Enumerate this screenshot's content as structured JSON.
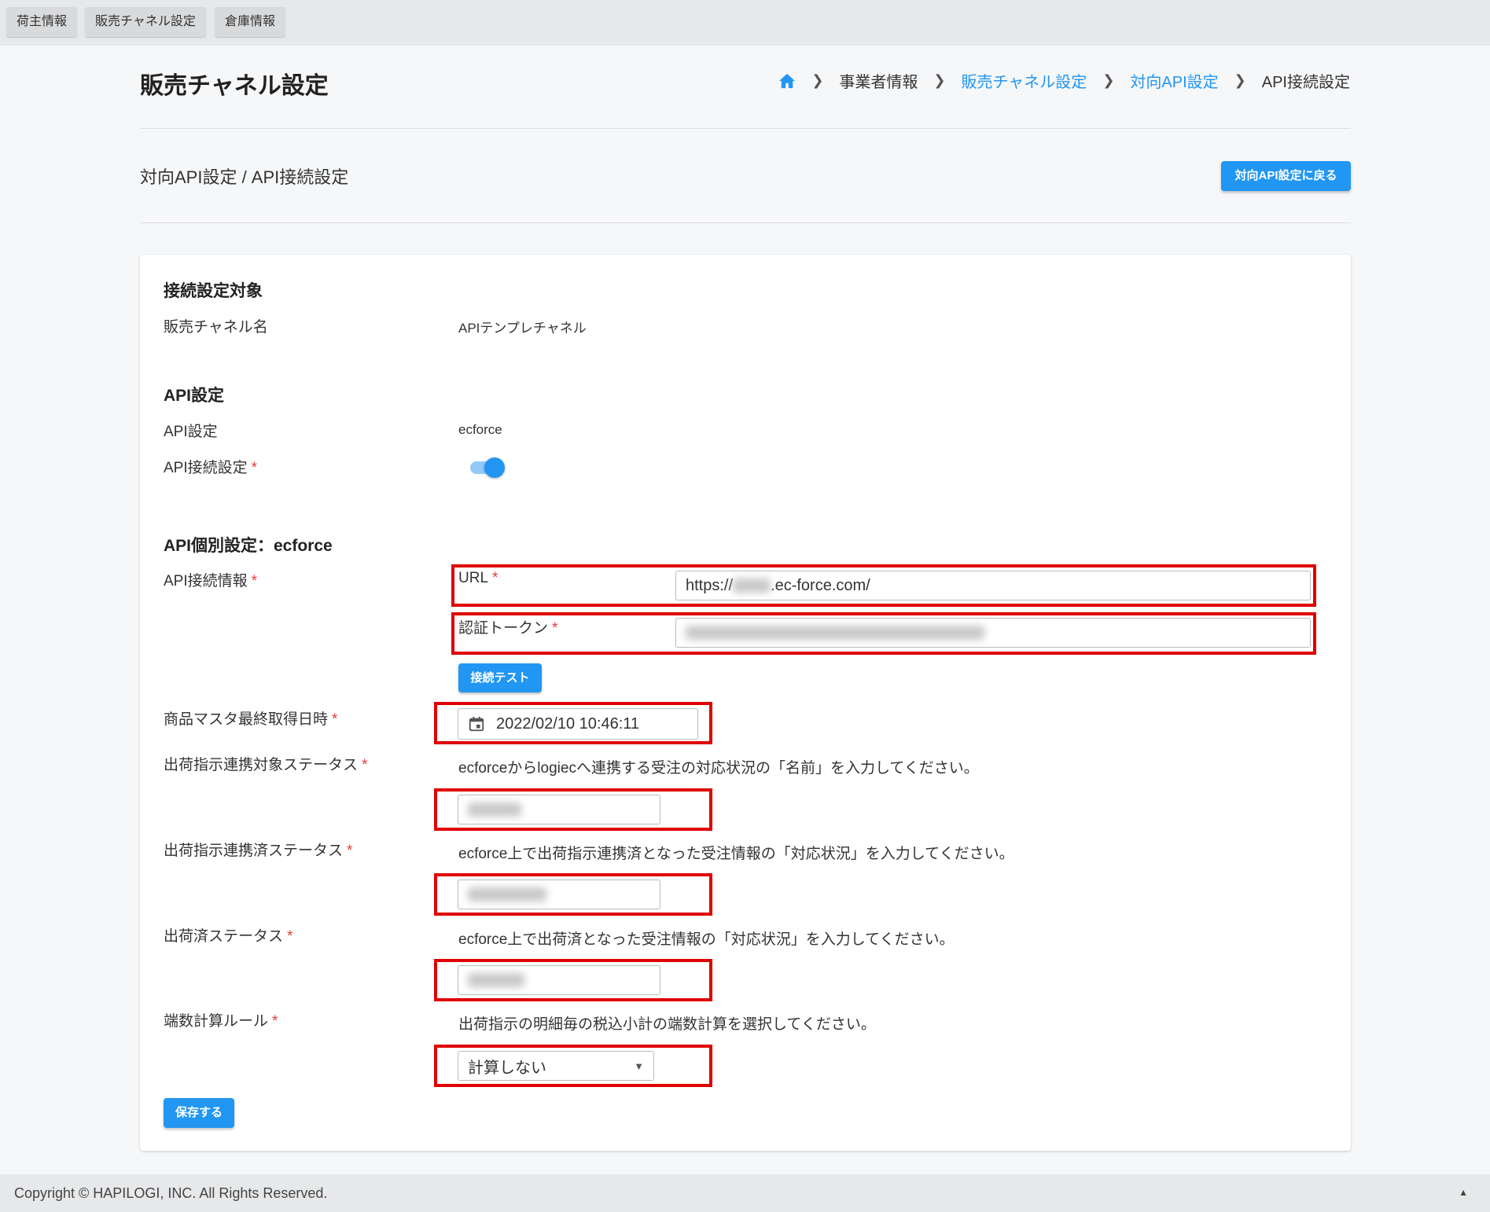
{
  "top_tabs": [
    "荷主情報",
    "販売チャネル設定",
    "倉庫情報"
  ],
  "header": {
    "title": "販売チャネル設定",
    "breadcrumb": [
      "事業者情報",
      "販売チャネル設定",
      "対向API設定",
      "API接続設定"
    ]
  },
  "subheader": {
    "title": "対向API設定 / API接続設定",
    "back_button": "対向API設定に戻る"
  },
  "target_section": {
    "title": "接続設定対象",
    "channel_label": "販売チャネル名",
    "channel_value": "APIテンプレチャネル"
  },
  "api_section": {
    "title": "API設定",
    "api_label": "API設定",
    "api_value": "ecforce",
    "connection_label": "API接続設定",
    "connection_enabled": true
  },
  "individual_section": {
    "title": "API個別設定：ecforce",
    "connection_info_label": "API接続情報",
    "url_label": "URL",
    "url_prefix": "https://",
    "url_suffix": ".ec-force.com/",
    "token_label": "認証トークン",
    "test_button": "接続テスト",
    "master_label": "商品マスタ最終取得日時",
    "master_datetime": "2022/02/10 10:46:11",
    "target_status_label": "出荷指示連携対象ステータス",
    "target_status_help": "ecforceからlogiecへ連携する受注の対応状況の「名前」を入力してください。",
    "linked_status_label": "出荷指示連携済ステータス",
    "linked_status_help": "ecforce上で出荷指示連携済となった受注情報の「対応状況」を入力してください。",
    "shipped_status_label": "出荷済ステータス",
    "shipped_status_help": "ecforce上で出荷済となった受注情報の「対応状況」を入力してください。",
    "rounding_label": "端数計算ルール",
    "rounding_help": "出荷指示の明細毎の税込小計の端数計算を選択してください。",
    "rounding_value": "計算しない",
    "required_mark": "*"
  },
  "save_button": "保存する",
  "footer": {
    "copyright": "Copyright © HAPILOGI, INC. All Rights Reserved."
  },
  "colors": {
    "primary": "#2196f3",
    "required": "#e53935",
    "highlight_box": "#e00000"
  }
}
